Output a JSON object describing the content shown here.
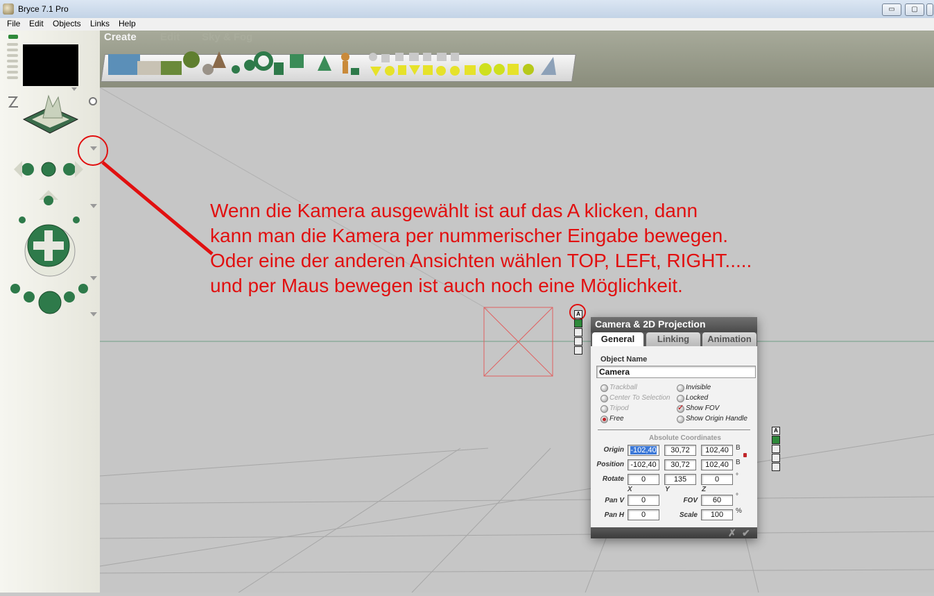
{
  "window": {
    "title": "Bryce 7.1  Pro",
    "minimize": "▭",
    "maximize": "▢",
    "close": "✕"
  },
  "menu": [
    "File",
    "Edit",
    "Objects",
    "Links",
    "Help"
  ],
  "toolbar": {
    "tabs": [
      "Create",
      "Edit",
      "Sky & Fog"
    ]
  },
  "annotation": {
    "lines": [
      "Wenn die Kamera ausgewählt ist auf das A klicken, dann",
      "kann man die Kamera per nummerischer Eingabe bewegen.",
      "Oder eine der anderen Ansichten wählen TOP, LEFt, RIGHT.....",
      "und per Maus bewegen ist auch noch eine Möglichkeit."
    ],
    "color": "#e11010"
  },
  "object_buttons": {
    "attributes": "A"
  },
  "camera_panel": {
    "title": "Camera & 2D Projection",
    "tabs": [
      "General",
      "Linking",
      "Animation"
    ],
    "object_name_label": "Object Name",
    "object_name": "Camera",
    "options_left": [
      "Trackball",
      "Center To Selection",
      "Tripod",
      "Free"
    ],
    "options_right": [
      "Invisible",
      "Locked",
      "Show FOV",
      "Show Origin Handle"
    ],
    "coordinates_heading": "Absolute Coordinates",
    "rows": {
      "origin": {
        "label": "Origin",
        "x": "-102,40",
        "y": "30,72",
        "z": "102,40",
        "unit": "B"
      },
      "position": {
        "label": "Position",
        "x": "-102,40",
        "y": "30,72",
        "z": "102,40",
        "unit": "B"
      },
      "rotate": {
        "label": "Rotate",
        "x": "0",
        "y": "135",
        "z": "0",
        "unit": "°"
      }
    },
    "axes": [
      "X",
      "Y",
      "Z"
    ],
    "pan_v": {
      "label": "Pan V",
      "value": "0"
    },
    "pan_h": {
      "label": "Pan H",
      "value": "0"
    },
    "fov": {
      "label": "FOV",
      "value": "60",
      "unit": "°"
    },
    "scale": {
      "label": "Scale",
      "value": "100",
      "unit": "%"
    },
    "footer": {
      "cancel": "✗",
      "ok": "✔"
    }
  }
}
